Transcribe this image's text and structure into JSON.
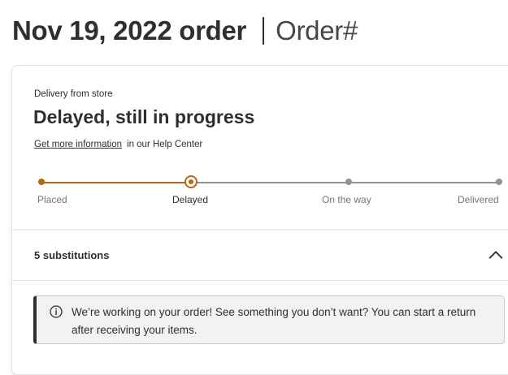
{
  "header": {
    "date_title": "Nov 19, 2022 order",
    "order_label": "Order#"
  },
  "status_card": {
    "delivery_type": "Delivery from store",
    "status_title": "Delayed, still in progress",
    "help_link": "Get more information",
    "help_suffix": "in our Help Center"
  },
  "tracker": {
    "steps": [
      "Placed",
      "Delayed",
      "On the way",
      "Delivered"
    ],
    "current_step_index": 1
  },
  "substitutions": {
    "label": "5 substitutions",
    "expanded": true
  },
  "alert": {
    "icon": "info-icon",
    "message": "We’re working on your order! See something you don’t want? You can start a return after receiving your items."
  },
  "colors": {
    "progress_done": "#b36a16",
    "progress_todo": "#909196",
    "text_primary": "#2e2f32"
  }
}
